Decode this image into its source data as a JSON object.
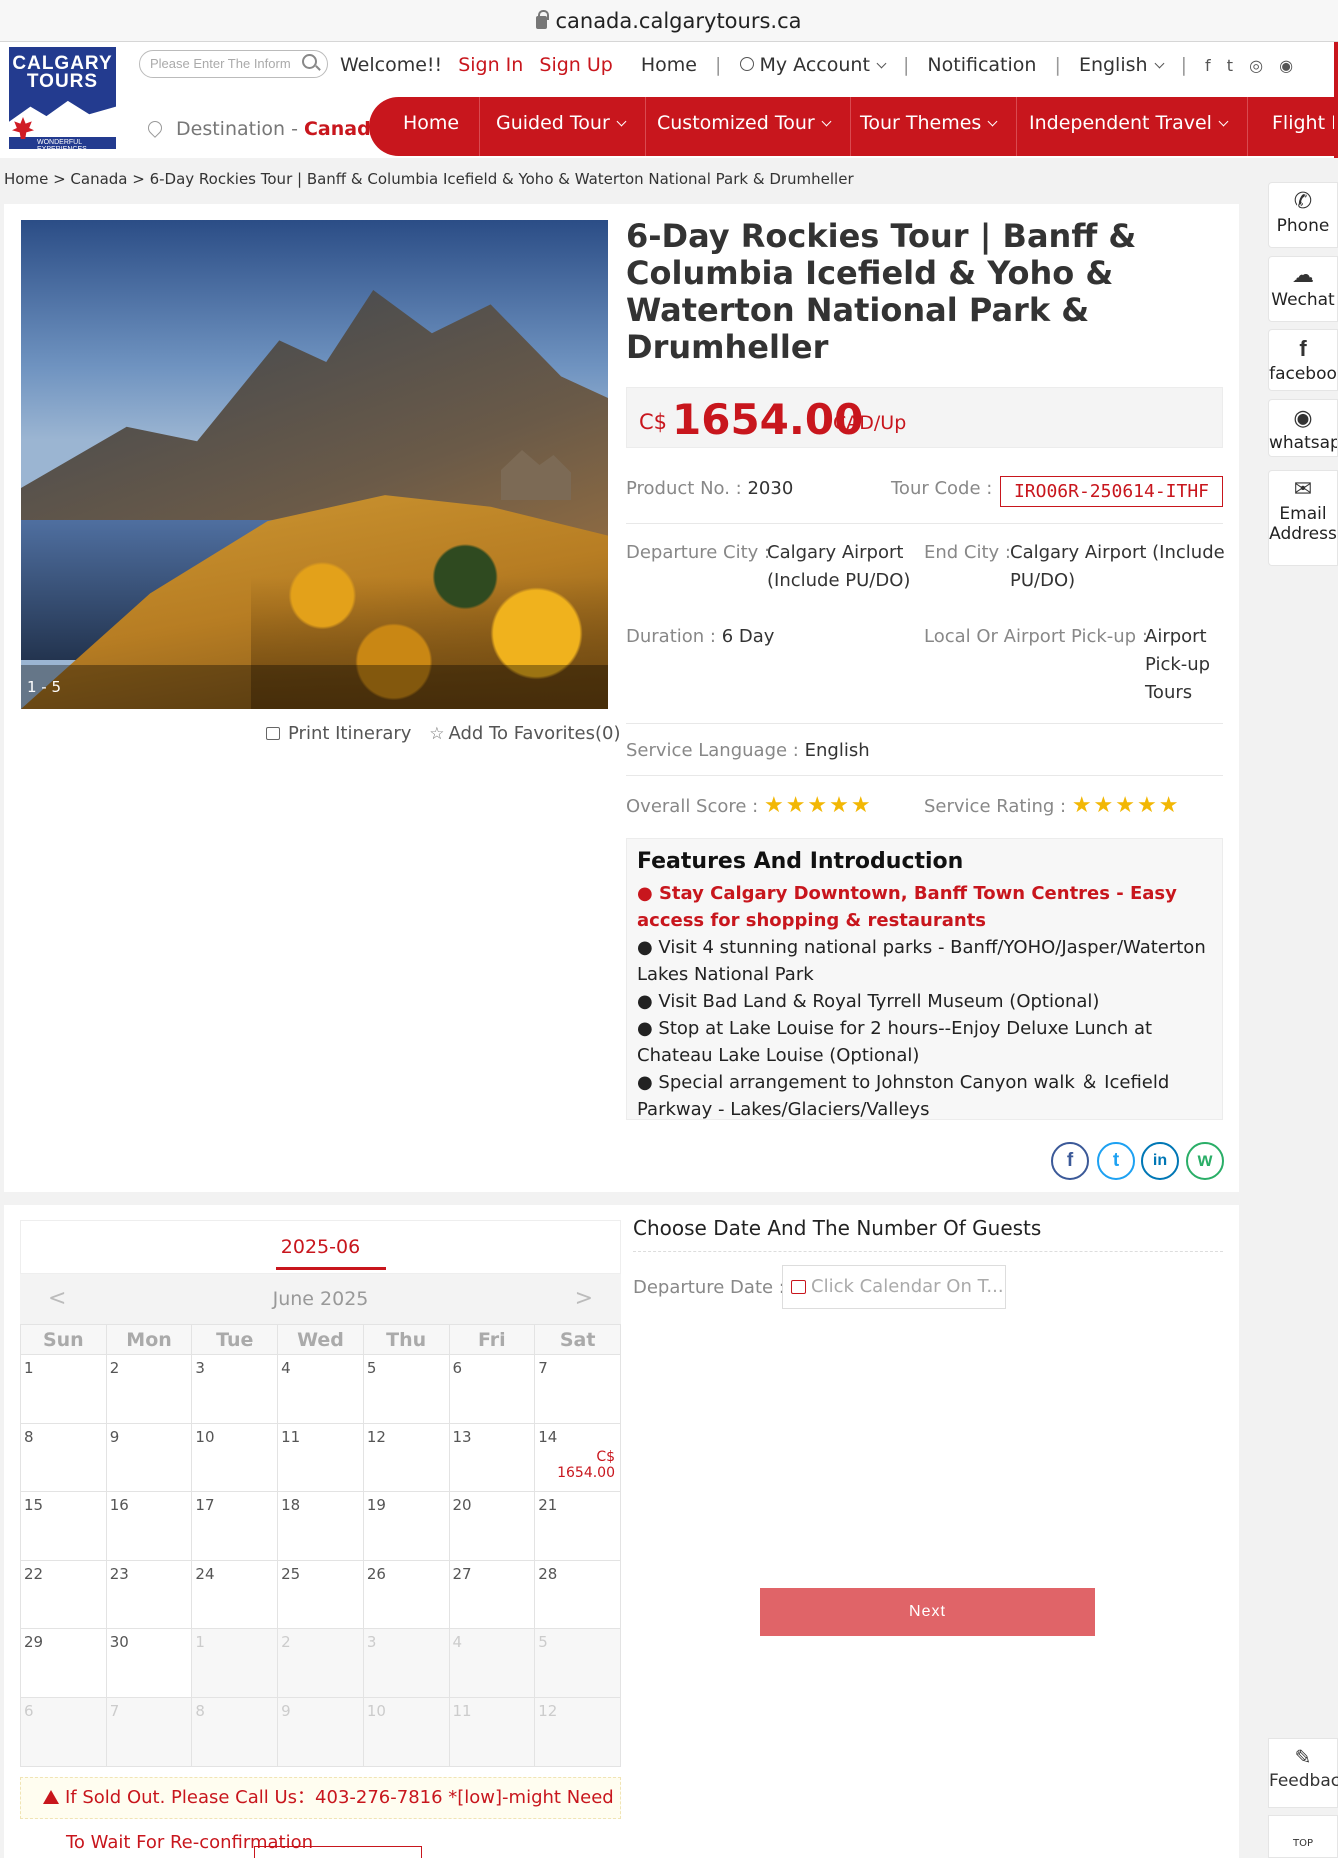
{
  "browser": {
    "url": "canada.calgarytours.ca"
  },
  "logo": {
    "line1": "CALGARY",
    "line2": "TOURS",
    "tagline": "WONDERFUL EXPERIENCES"
  },
  "search": {
    "placeholder": "Please Enter The Inform"
  },
  "topnav": {
    "welcome": "Welcome!!",
    "sign_in": "Sign In",
    "sign_up": "Sign Up",
    "home": "Home",
    "my_account": "My Account",
    "notification": "Notification",
    "language": "English",
    "sep": "|"
  },
  "destination": {
    "label": "Destination - ",
    "value": "Canada"
  },
  "mainnav": [
    "Home",
    "Guided Tour",
    "Customized Tour",
    "Tour Themes",
    "Independent Travel",
    "Flight Deals"
  ],
  "breadcrumb": "Home > Canada > 6-Day Rockies Tour | Banff & Columbia Icefield & Yoho & Waterton National Park & Drumheller",
  "gallery": {
    "counter": "1 - 5"
  },
  "actions": {
    "print": "Print Itinerary",
    "favorites": "Add To Favorites(0)"
  },
  "product": {
    "title": "6-Day Rockies Tour | Banff & Columbia Icefield & Yoho & Waterton National Park & Drumheller",
    "price_currency": "C$",
    "price": "1654.00",
    "price_unit": "CAD/Up",
    "product_no_label": "Product No. :",
    "product_no": "2030",
    "tour_code_label": "Tour Code :",
    "tour_code": "IRO06R-250614-ITHF",
    "departure_label": "Departure City :",
    "departure_line1": "Calgary Airport",
    "departure_line2": "(Include PU/DO)",
    "end_label": "End City :",
    "end_line1": "Calgary Airport (Include",
    "end_line2": "PU/DO)",
    "duration_label": "Duration :",
    "duration": "6 Day",
    "pickup_label": "Local Or Airport Pick-up :",
    "pickup_line1": "Airport",
    "pickup_line2": "Pick-up",
    "pickup_line3": "Tours",
    "language_label": "Service Language :",
    "language": "English",
    "overall_label": "Overall Score :",
    "overall_stars": 5,
    "rating_label": "Service Rating :",
    "rating_stars": 5
  },
  "features": {
    "heading": "Features And Introduction",
    "items": [
      "● Stay Calgary Downtown, Banff Town Centres  - Easy access for shopping & restaurants",
      "● Visit 4 stunning national parks - Banff/YOHO/Jasper/Waterton Lakes National Park",
      "● Visit Bad Land & Royal Tyrrell Museum (Optional)",
      "● Stop at Lake Louise for 2 hours--Enjoy Deluxe Lunch at Chateau Lake Louise (Optional)",
      "● Special arrangement to Johnston Canyon walk ＆ Icefield Parkway - Lakes/Glaciers/Valleys"
    ]
  },
  "share": {
    "facebook": "f",
    "twitter": "t",
    "linkedin": "in",
    "wechat": "w"
  },
  "sidebar": {
    "phone": "Phone",
    "wechat": "Wechat",
    "facebook": "faceboo",
    "whatsapp": "whatsap",
    "email_line1": "Email",
    "email_line2": "Address",
    "feedback": "Feedbac",
    "top": "TOP"
  },
  "calendar": {
    "tab": "2025-06",
    "month": "June 2025",
    "prev": "<",
    "next": ">",
    "weekdays": [
      "Sun",
      "Mon",
      "Tue",
      "Wed",
      "Thu",
      "Fri",
      "Sat"
    ],
    "weeks": [
      [
        "1",
        "2",
        "3",
        "4",
        "5",
        "6",
        "7"
      ],
      [
        "8",
        "9",
        "10",
        "11",
        "12",
        "13",
        "14"
      ],
      [
        "15",
        "16",
        "17",
        "18",
        "19",
        "20",
        "21"
      ],
      [
        "22",
        "23",
        "24",
        "25",
        "26",
        "27",
        "28"
      ],
      [
        "29",
        "30",
        "1",
        "2",
        "3",
        "4",
        "5"
      ],
      [
        "6",
        "7",
        "8",
        "9",
        "10",
        "11",
        "12"
      ]
    ],
    "price_day": "14",
    "price_cur": "C$",
    "price_val": "1654.00"
  },
  "booking": {
    "heading": "Choose Date And The Number Of Guests",
    "departure_label": "Departure Date :",
    "departure_placeholder": "Click Calendar On T...",
    "next": "Next"
  },
  "soldout": {
    "line1": "If Sold Out. Please Call Us：403-276-7816 *[low]-might Need",
    "line2": "To Wait For Re-confirmation"
  },
  "colors": {
    "brand_red": "#c8161d",
    "logo_blue": "#233b8f",
    "star": "#f2b705",
    "next_button": "#e06468"
  }
}
